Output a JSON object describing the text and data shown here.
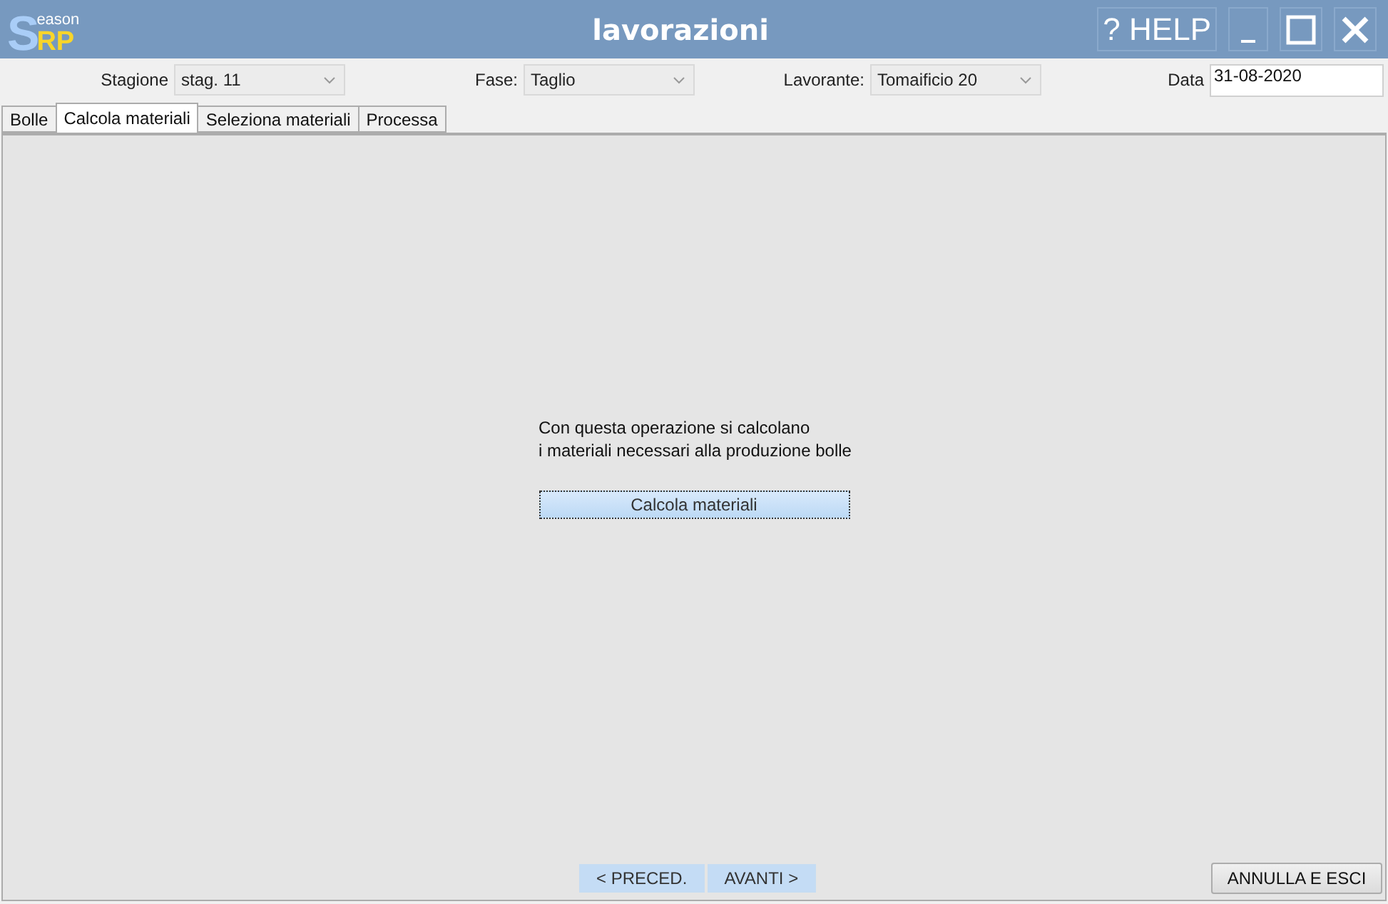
{
  "logo": {
    "big_letter": "S",
    "small_text": "eason",
    "accent_text": "RP"
  },
  "window": {
    "title": "lavorazioni",
    "help_button": "? HELP"
  },
  "filters": [
    {
      "kind": "dropdown",
      "label": "Stagione",
      "value": "stag. 11"
    },
    {
      "kind": "dropdown",
      "label": "Fase:",
      "value": "Taglio"
    },
    {
      "kind": "dropdown",
      "label": "Lavorante:",
      "value": "Tomaificio 20"
    },
    {
      "kind": "field",
      "label": "Data",
      "value": "31-08-2020"
    }
  ],
  "tabs": [
    {
      "label": "Bolle",
      "selected": false
    },
    {
      "label": "Calcola materiali",
      "selected": true
    },
    {
      "label": "Seleziona materiali",
      "selected": false
    },
    {
      "label": "Processa",
      "selected": false
    }
  ],
  "panel": {
    "message_lines": [
      "Con questa operazione si calcolano",
      "i materiali necessari alla produzione bolle"
    ],
    "action_button": "Calcola materiali"
  },
  "nav_buttons": [
    "< PRECED.",
    "AVANTI >"
  ],
  "exit_button": "ANNULLA E ESCI"
}
